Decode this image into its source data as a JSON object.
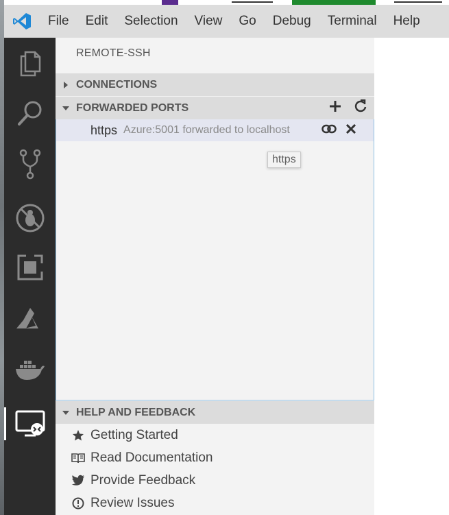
{
  "menubar": {
    "items": [
      "File",
      "Edit",
      "Selection",
      "View",
      "Go",
      "Debug",
      "Terminal",
      "Help"
    ]
  },
  "activity_bar": {
    "icons": [
      "explorer-icon",
      "search-icon",
      "source-control-icon",
      "debug-icon",
      "extensions-icon",
      "azure-icon",
      "docker-icon",
      "remote-explorer-icon"
    ],
    "active": "remote-explorer-icon"
  },
  "sidebar": {
    "title": "REMOTE-SSH",
    "connections": {
      "label": "CONNECTIONS"
    },
    "forwarded_ports": {
      "label": "FORWARDED PORTS",
      "ports": [
        {
          "name": "https",
          "description": "Azure:5001 forwarded to localhost"
        }
      ]
    },
    "tooltip": "https",
    "help": {
      "label": "HELP AND FEEDBACK",
      "items": [
        {
          "label": "Getting Started",
          "icon": "star-icon"
        },
        {
          "label": "Read Documentation",
          "icon": "book-icon"
        },
        {
          "label": "Provide Feedback",
          "icon": "twitter-icon"
        },
        {
          "label": "Review Issues",
          "icon": "issues-icon"
        }
      ]
    }
  },
  "colors": {
    "activity_bar": "#2c2c2c",
    "sidebar": "#f3f3f3",
    "section_header": "#dcdcdc",
    "selected_row": "#e4e6f1",
    "accent": "#007acc"
  }
}
